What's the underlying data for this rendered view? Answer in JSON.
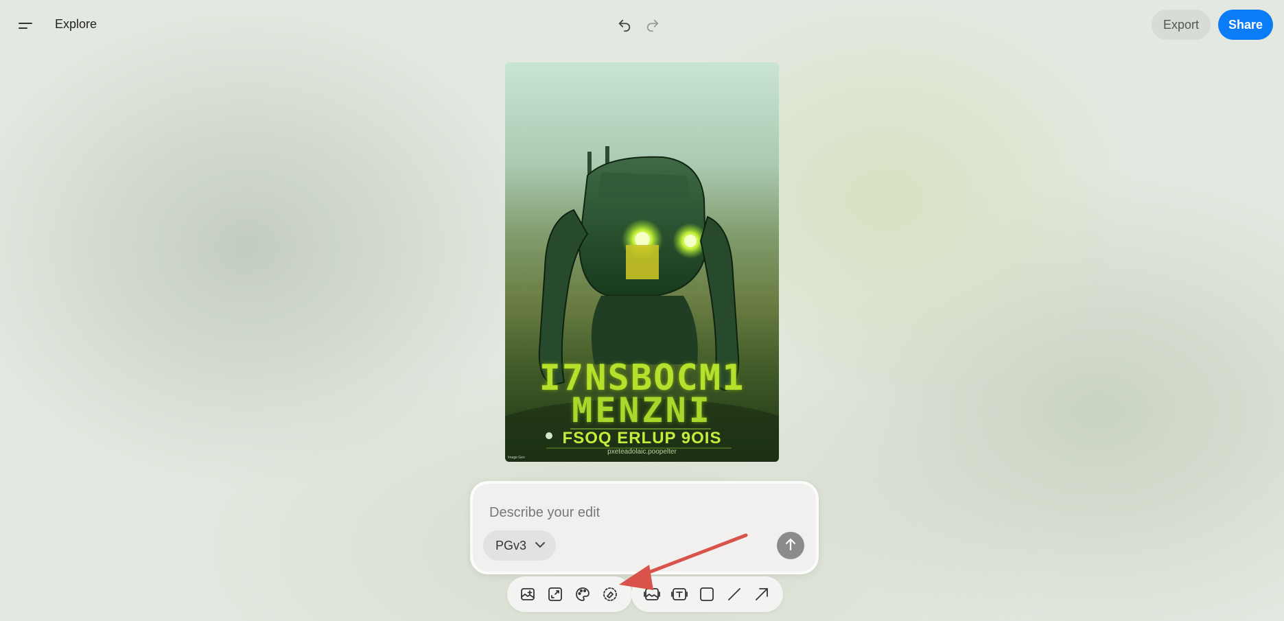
{
  "header": {
    "menu_icon": "hamburger-menu-icon",
    "title": "Explore",
    "undo_icon": "undo-icon",
    "redo_icon": "redo-icon",
    "export_label": "Export",
    "share_label": "Share"
  },
  "artwork": {
    "title_line1": "I7NSBOCM1",
    "title_line2": "MENZNI",
    "subtitle": "FSOQ ERLUP 9OIS",
    "small_text": "pxeteadolaic.poopelter",
    "corner_text": "Image Gen"
  },
  "prompt": {
    "placeholder": "Describe your edit",
    "model_label": "PGv3",
    "send_icon": "arrow-up-icon"
  },
  "toolbar": {
    "group1": [
      "add-image-icon",
      "expand-icon",
      "palette-icon",
      "eraser-icon"
    ],
    "group2": [
      "image-frame-icon",
      "text-box-icon",
      "square-icon",
      "line-icon",
      "arrow-icon"
    ]
  },
  "colors": {
    "accent": "#0a7cf5",
    "annotation_arrow": "#d9534a"
  }
}
